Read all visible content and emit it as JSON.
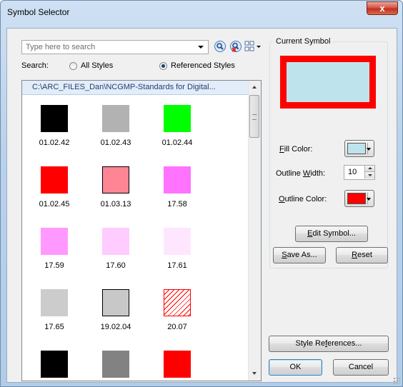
{
  "window": {
    "title": "Symbol Selector",
    "close_glyph": "x"
  },
  "search": {
    "placeholder": "Type here to search",
    "label": "Search:",
    "options": [
      "All Styles",
      "Referenced Styles"
    ],
    "selected": "Referenced Styles"
  },
  "toolbar": {
    "icons": [
      "search-icon",
      "clear-search-icon",
      "view-options-icon"
    ]
  },
  "list": {
    "header": "C:\\ARC_FILES_Dan\\NCGMP-Standards for Digital...",
    "items": [
      {
        "label": "01.02.42",
        "fill": "#000000",
        "outline": ""
      },
      {
        "label": "01.02.43",
        "fill": "#b2b2b2",
        "outline": ""
      },
      {
        "label": "01.02.44",
        "fill": "#00ff00",
        "outline": ""
      },
      {
        "label": "01.02.45",
        "fill": "#ff0000",
        "outline": ""
      },
      {
        "label": "01.03.13",
        "fill": "#ff8595",
        "outline": "#000000"
      },
      {
        "label": "17.58",
        "fill": "#ff73ff",
        "outline": ""
      },
      {
        "label": "17.59",
        "fill": "#ff99ff",
        "outline": ""
      },
      {
        "label": "17.60",
        "fill": "#ffccff",
        "outline": ""
      },
      {
        "label": "17.61",
        "fill": "#ffe6ff",
        "outline": ""
      },
      {
        "label": "17.65",
        "fill": "#cccccc",
        "outline": ""
      },
      {
        "label": "19.02.04",
        "fill": "#c8c8c8",
        "outline": "#000000"
      },
      {
        "label": "20.07",
        "fill": "hatch",
        "outline": "#ff0000"
      },
      {
        "label": "",
        "fill": "#000000",
        "outline": ""
      },
      {
        "label": "",
        "fill": "#828282",
        "outline": ""
      },
      {
        "label": "",
        "fill": "#ff0000",
        "outline": ""
      }
    ]
  },
  "current_symbol": {
    "group_title": "Current Symbol",
    "preview_fill": "#bfe3ec",
    "preview_outline": "#ff0000"
  },
  "properties": {
    "fill_color_label": {
      "key": "F",
      "rest": "ill Color:"
    },
    "fill_color": "#bfe3ec",
    "outline_width_label": {
      "pre": "Outline ",
      "key": "W",
      "rest": "idth:"
    },
    "outline_width": "10",
    "outline_color_label": {
      "key": "O",
      "rest": "utline Color:"
    },
    "outline_color": "#ff0000"
  },
  "buttons": {
    "edit_symbol": {
      "key": "E",
      "rest": "dit Symbol..."
    },
    "save_as": {
      "key": "S",
      "rest": "ave As..."
    },
    "reset": {
      "key": "R",
      "rest": "eset"
    },
    "style_references": {
      "pre": "Style Re",
      "key": "f",
      "rest": "erences..."
    },
    "ok": "OK",
    "cancel": "Cancel"
  }
}
